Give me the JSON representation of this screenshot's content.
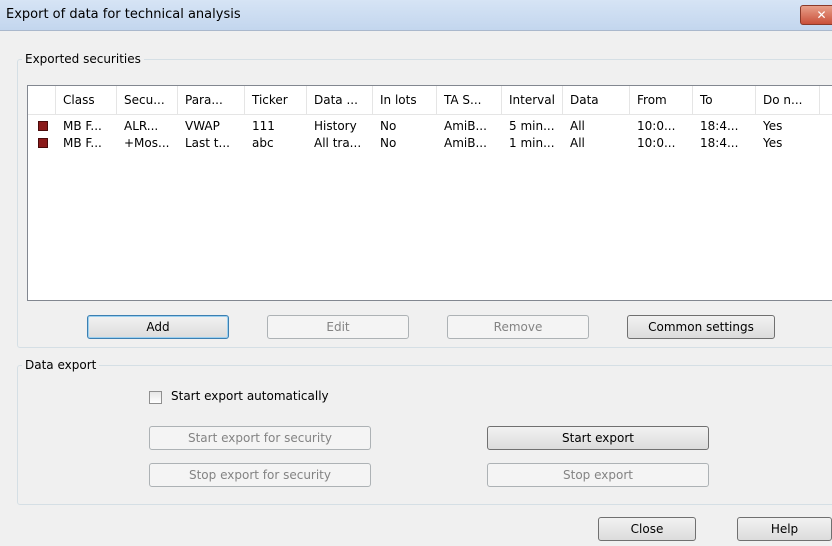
{
  "window": {
    "title": "Export of data for technical analysis",
    "close_glyph": "✕"
  },
  "exported": {
    "legend": "Exported securities",
    "columns": [
      "Class",
      "Secu...",
      "Para...",
      "Ticker",
      "Data ...",
      "In lots",
      "TA S...",
      "Interval",
      "Data",
      "From",
      "To",
      "Do n..."
    ],
    "rows": [
      {
        "marker_color": "#8b1a1a",
        "cells": [
          "MB F...",
          "ALR...",
          "VWAP",
          "111",
          "History",
          "No",
          "AmiB...",
          "5 min...",
          "All",
          "10:0...",
          "18:4...",
          "Yes"
        ]
      },
      {
        "marker_color": "#8b1a1a",
        "cells": [
          "MB F...",
          "+Mos...",
          "Last t...",
          "abc",
          "All tra...",
          "No",
          "AmiB...",
          "1 min...",
          "All",
          "10:0...",
          "18:4...",
          "Yes"
        ]
      }
    ],
    "buttons": {
      "add": "Add",
      "edit": "Edit",
      "remove": "Remove",
      "common": "Common settings"
    }
  },
  "data_export": {
    "legend": "Data export",
    "auto_label": "Start export automatically",
    "auto_checked": false,
    "start_security": "Start export for security",
    "stop_security": "Stop export for security",
    "start_export": "Start export",
    "stop_export": "Stop export"
  },
  "footer": {
    "close": "Close",
    "help": "Help"
  }
}
